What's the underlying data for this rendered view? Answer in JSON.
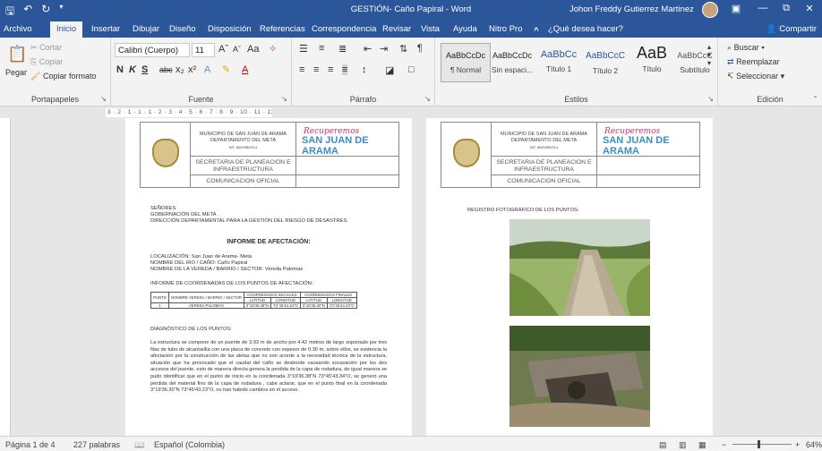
{
  "titlebar": {
    "doc_title": "GESTIÓN- Caño Papiral  -  Word",
    "user": "Johon Freddy Gutierrez Martinez",
    "save_icon": "save-icon",
    "undo_icon": "undo-icon",
    "redo_icon": "redo-icon"
  },
  "menu": {
    "tabs": [
      "Archivo",
      "Inicio",
      "Insertar",
      "Dibujar",
      "Diseño",
      "Disposición",
      "Referencias",
      "Correspondencia",
      "Revisar",
      "Vista",
      "Ayuda",
      "Nitro Pro"
    ],
    "active_tab": "Inicio",
    "tell_me": "¿Qué desea hacer?",
    "share": "Compartir"
  },
  "ribbon": {
    "clipboard": {
      "label": "Portapapeles",
      "paste": "Pegar",
      "cut": "Cortar",
      "copy": "Copiar",
      "format_painter": "Copiar formato"
    },
    "font": {
      "label": "Fuente",
      "font_name": "Calibri (Cuerpo)",
      "font_size": "11",
      "bold": "N",
      "italic": "K",
      "underline": "S"
    },
    "paragraph": {
      "label": "Párrafo"
    },
    "styles": {
      "label": "Estilos",
      "items": [
        {
          "preview": "AaBbCcDc",
          "name": "¶ Normal"
        },
        {
          "preview": "AaBbCcDc",
          "name": "Sin espaci..."
        },
        {
          "preview": "AaBbCc",
          "name": "Título 1"
        },
        {
          "preview": "AaBbCcC",
          "name": "Título 2"
        },
        {
          "preview": "AaB",
          "name": "Título"
        },
        {
          "preview": "AaBbCcC",
          "name": "Subtítulo"
        }
      ]
    },
    "editing": {
      "label": "Edición",
      "find": "Buscar",
      "replace": "Reemplazar",
      "select": "Seleccionar"
    }
  },
  "ruler": {
    "text": "3 · 2 · 1 · 1 · 1 · 2 · 3 · 4 · 5 · 6 · 7 · 8 · 9 · 10 · 11 · 12 · 13 · 14 · 15 · 16 · 17 · 18 ·"
  },
  "page_header": {
    "muni": "MUNICIPIO DE SAN JUAN DE ARAMA",
    "depto": "DEPARTAMENTO DEL META",
    "nit": "NIT: 800098929-4",
    "secretaria": "SECRETARIA DE PLANEACION E INFRAESTRUCTURA",
    "comunicacion": "COMUNICACION OFICIAL",
    "brand1": "Recuperemos",
    "brand2": "SAN JUAN DE ARAMA"
  },
  "page1": {
    "lines": [
      "SEÑORES",
      "GOBERNACIÓN DEL META",
      "DIRECCIÓN DEPARTAMENTAL PARA LA GESTIÓN DEL RIESGO DE DESASTRES."
    ],
    "report_title": "INFORME DE AFECTACIÓN:",
    "loc": [
      "LOCALIZACIÓN: San Juan de Arama- Meta",
      "NOMBRE DEL RIO / CAÑO: Caño Papiral",
      "NOMBRE DE LA VEREDA / BARRIO / SECTOR: Vereda Palomas"
    ],
    "coords_title": "INFORME DE COORDENADAS DE LOS PUNTOS DE AFECTACIÓN:",
    "table": {
      "h1": [
        "PUNTO",
        "NOMBRE VEREDA / BARRIO / SECTOR",
        "COORDENADAS INICIALES",
        "COORDENADAS FINALES"
      ],
      "h2": [
        "LATITUD",
        "LONGITUD",
        "LATITUD",
        "LONGITUD"
      ],
      "row": [
        "1",
        "VEREDA PALOMAS",
        "3°19'36.38\"N",
        "73°45'43.34\"O",
        "3°19'36.30\"N",
        "73°45'43.23\"O"
      ]
    },
    "diag_title": "DIAGNÓSTICO DE LOS PUNTOS:",
    "diag_text": "La estructura se compone de un puente de 3.93 m de ancho por 4.42 metros de largo soportado por tres filas de tubo de alcantarilla con una placa de concreto con espesor de 0.30 m, sobre ellos, se evidencia la afectación por la construcción de las aletas que no son acorde a la necesidad técnica de la estructura, situación que ha provocado que el caudal del caño se desborde causando socavación por los dos accesos del puente, esto de manera directa genera la perdida de la capa de rodadura, de igual manera se pudo identificar que en el punto de inicio en la coordenada 3°19'36.38\"N 73°45'43.34\"O, se generó una pérdida del material fino de la capa de rodadura , cabe aclarar, que en el punto final en la coordenada 3°19'36.30\"N 73°45'43.23\"O, no han habido cambios en el acceso."
  },
  "page2": {
    "photo_title": "REGISTRO FOTOGRÁFICO DE LOS PUNTOS:"
  },
  "status": {
    "page": "Página 1 de 4",
    "words": "227 palabras",
    "lang": "Español (Colombia)",
    "zoom": "64%"
  }
}
